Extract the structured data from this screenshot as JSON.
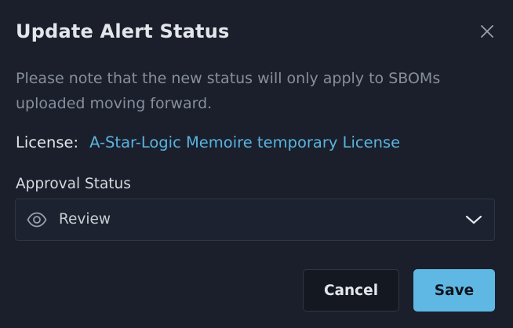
{
  "dialog": {
    "title": "Update Alert Status",
    "note": "Please note that the new status will only apply to SBOMs uploaded moving forward.",
    "license_label": "License:",
    "license_value": "A-Star-Logic Memoire temporary License",
    "approval_label": "Approval Status",
    "approval_selected": "Review",
    "approval_icon": "eye-icon",
    "cancel_label": "Cancel",
    "save_label": "Save"
  },
  "colors": {
    "background": "#1a1f2b",
    "link": "#5bb3df",
    "primary_button": "#5fb8e4",
    "secondary_button": "#141821",
    "border": "#2f3542"
  }
}
